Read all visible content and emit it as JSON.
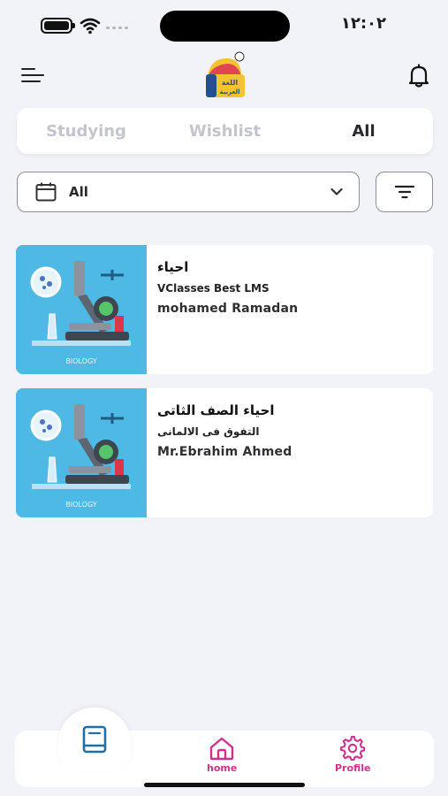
{
  "status_bar": {
    "time": "١٢:٠٢"
  },
  "header": {
    "logo_text": "اللغة العربية"
  },
  "tabs": [
    {
      "label": "Studying",
      "active": false
    },
    {
      "label": "Wishlist",
      "active": false
    },
    {
      "label": "All",
      "active": true
    }
  ],
  "filters": {
    "date_value": "All"
  },
  "courses": [
    {
      "title": "احياء",
      "organization": "VClasses Best LMS",
      "teacher": "mohamed Ramadan",
      "thumbnail_caption": "BIOLOGY"
    },
    {
      "title": "احياء الصف الثاتى",
      "organization": "التفوق فى الالمانى",
      "teacher": "Mr.Ebrahim Ahmed",
      "thumbnail_caption": "BIOLOGY"
    }
  ],
  "bottom_nav": {
    "home_label": "home",
    "profile_label": "Profile"
  },
  "colors": {
    "accent": "#d2308e",
    "background": "#f2f3f8",
    "thumbnail_bg": "#4fb9e6",
    "book_icon": "#1f6fa8"
  }
}
